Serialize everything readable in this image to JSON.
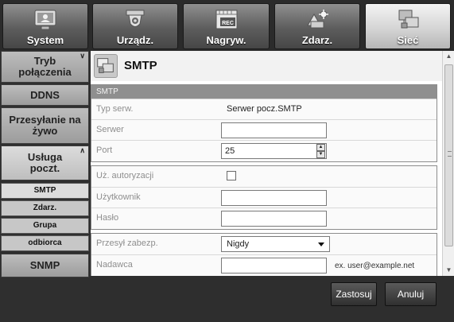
{
  "nav": {
    "tabs": [
      {
        "label": "System",
        "icon": "system-icon"
      },
      {
        "label": "Urządz.",
        "icon": "camera-icon"
      },
      {
        "label": "Nagryw.",
        "icon": "rec-icon",
        "icon_text": "REC"
      },
      {
        "label": "Zdarz.",
        "icon": "event-icon"
      },
      {
        "label": "Sieć",
        "icon": "network-icon"
      }
    ],
    "active_tab": "Sieć"
  },
  "sidebar": {
    "items": [
      {
        "label": "Tryb połączenia",
        "expanded": false
      },
      {
        "label": "DDNS"
      },
      {
        "label": "Przesyłanie na żywo"
      },
      {
        "label": "Usługa poczt.",
        "expanded": true
      }
    ],
    "subitems": [
      {
        "label": "SMTP",
        "selected": true
      },
      {
        "label": "Zdarz."
      },
      {
        "label": "Grupa"
      },
      {
        "label": "odbiorca"
      }
    ],
    "after": [
      {
        "label": "SNMP"
      }
    ]
  },
  "header": {
    "title": "SMTP",
    "icon": "network-icon"
  },
  "smtp_group": {
    "heading": "SMTP",
    "rows": [
      {
        "label": "Typ serw.",
        "value": "Serwer pocz.SMTP"
      },
      {
        "label": "Serwer",
        "value": ""
      },
      {
        "label": "Port",
        "value": "25"
      }
    ]
  },
  "auth_group": {
    "rows": [
      {
        "label": "Uż. autoryzacji",
        "checked": false
      },
      {
        "label": "Użytkownik",
        "value": ""
      },
      {
        "label": "Hasło",
        "value": ""
      }
    ]
  },
  "secure_group": {
    "rows": [
      {
        "label": "Przesył zabezp.",
        "value": "Nigdy"
      },
      {
        "label": "Nadawca",
        "value": "",
        "hint": "ex. user@example.net"
      }
    ]
  },
  "buttons": {
    "apply": "Zastosuj",
    "cancel": "Anuluj"
  },
  "colors": {
    "active_tab": "#d8d8d8",
    "group_header": "#8f8f8f",
    "background": "#2a2a2a"
  }
}
